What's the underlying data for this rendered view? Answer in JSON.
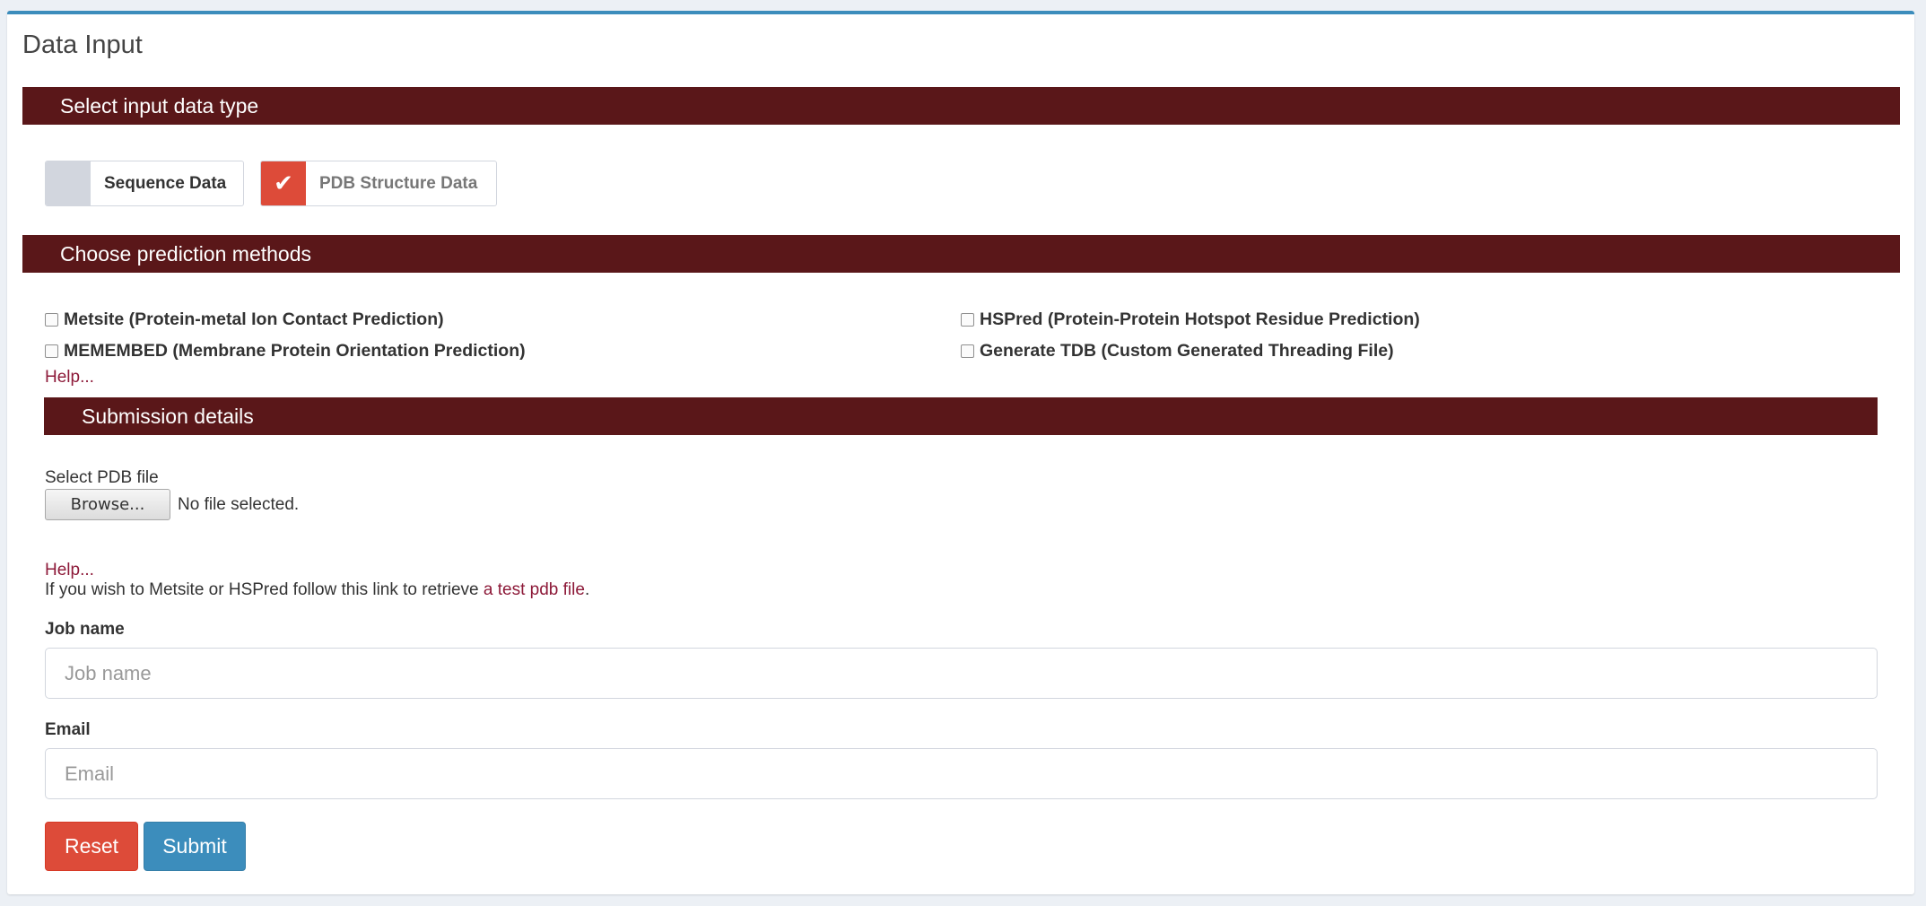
{
  "panel": {
    "title": "Data Input"
  },
  "sections": {
    "input_type": "Select input data type",
    "methods": "Choose prediction methods",
    "submission": "Submission details"
  },
  "toggles": {
    "sequence": {
      "label": "Sequence Data",
      "checked": false
    },
    "pdb": {
      "label": "PDB Structure Data",
      "checked": true,
      "mark": "✔"
    }
  },
  "methods": {
    "metsite": "Metsite (Protein-metal Ion Contact Prediction)",
    "memembed": "MEMEMBED (Membrane Protein Orientation Prediction)",
    "hspred": "HSPred (Protein-Protein Hotspot Residue Prediction)",
    "gentdb": "Generate TDB (Custom Generated Threading File)"
  },
  "help": {
    "link1": "Help...",
    "link2": "Help..."
  },
  "file": {
    "label": "Select PDB file",
    "button": "Browse...",
    "status": "No file selected."
  },
  "info": {
    "text": "If you wish to Metsite or HSPred follow this link to retrieve ",
    "link": "a test pdb file",
    "suffix": "."
  },
  "fields": {
    "job_name": {
      "label": "Job name",
      "placeholder": "Job name",
      "value": ""
    },
    "email": {
      "label": "Email",
      "placeholder": "Email",
      "value": ""
    }
  },
  "buttons": {
    "reset": "Reset",
    "submit": "Submit"
  },
  "colors": {
    "section_bar": "#5a1719",
    "accent_top": "#3c8dbc",
    "toggle_on": "#dd4b39",
    "reset": "#dd4b39",
    "submit": "#3c8dbc",
    "link": "#8d1a39"
  }
}
